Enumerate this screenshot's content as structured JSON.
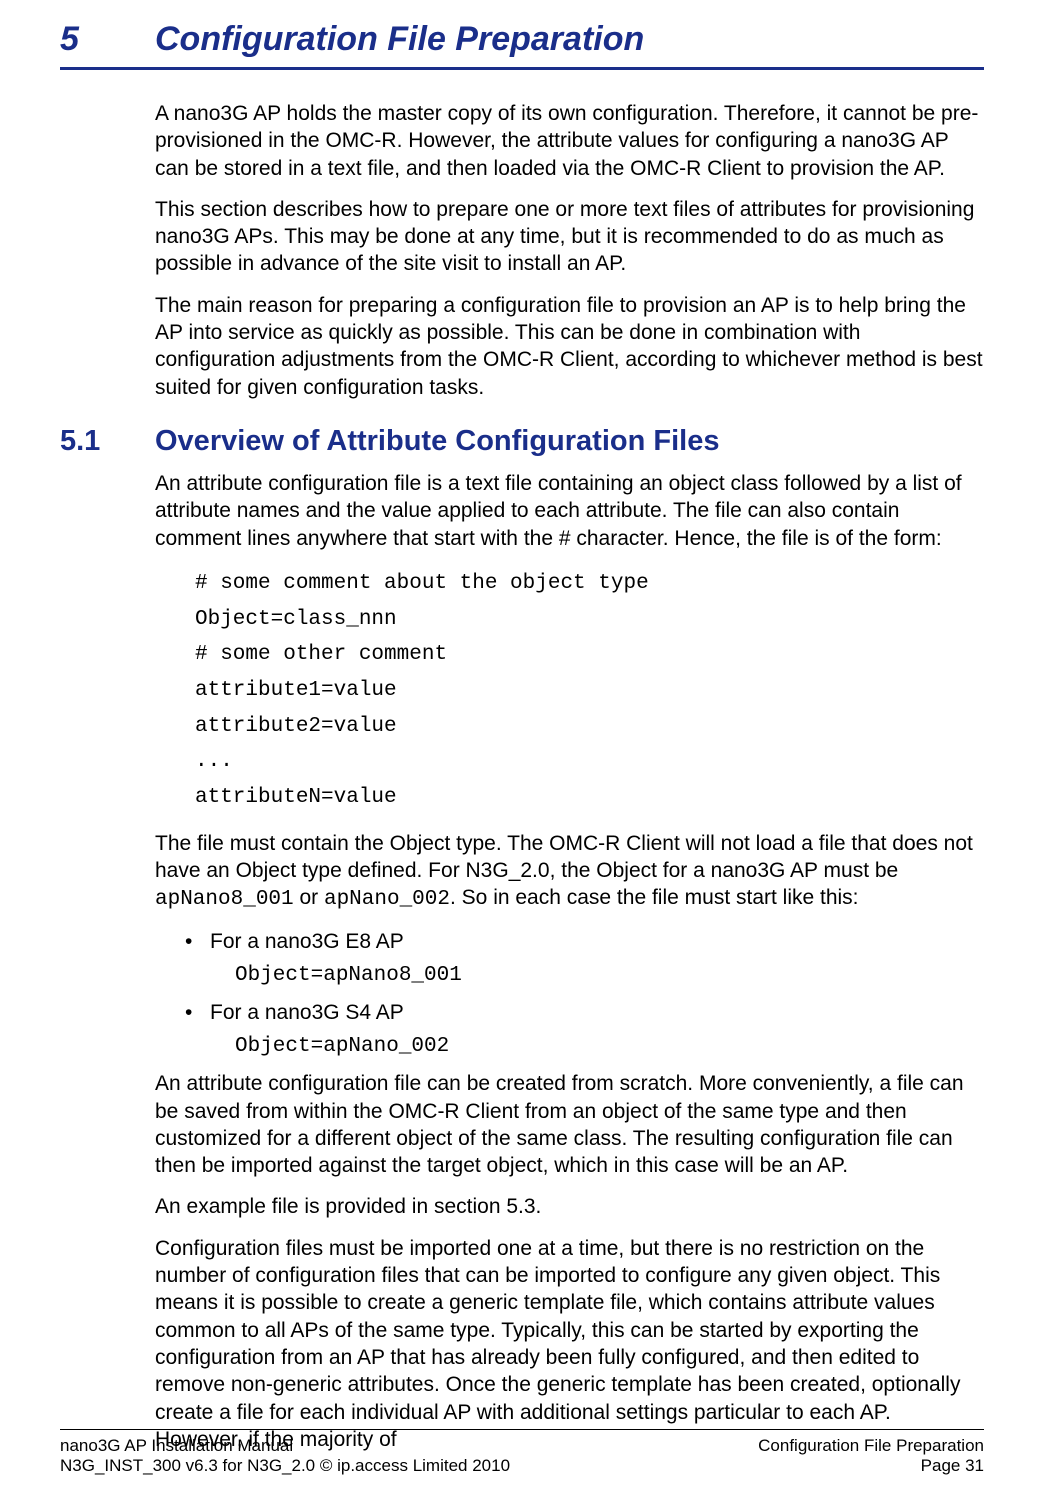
{
  "chapter": {
    "number": "5",
    "title": "Configuration File Preparation"
  },
  "intro": {
    "p1": "A nano3G AP holds the master copy of its own configuration. Therefore, it cannot be pre-provisioned in the OMC-R. However, the attribute values for configuring a nano3G AP can be stored in a text file, and then loaded via the OMC-R Client to provision the AP.",
    "p2": "This section describes how to prepare one or more text files of attributes for provisioning nano3G APs. This may be done at any time, but it is recommended to do as much as possible in advance of the site visit to install an AP.",
    "p3": "The main reason for preparing a configuration file to provision an AP is to help bring the AP into service as quickly as possible. This can be done in combination with configuration adjustments from the OMC-R Client, according to whichever method is best suited for given configuration tasks."
  },
  "section": {
    "number": "5.1",
    "title": "Overview of Attribute Configuration Files",
    "p1": "An attribute configuration file is a text file containing an object class followed by a list of attribute names and the value applied to each attribute. The file can also contain comment lines anywhere that start with the # character. Hence, the file is of the form:",
    "code": {
      "l1": "# some comment about the object type",
      "l2": "Object=class_nnn",
      "l3": "# some other comment",
      "l4": "attribute1=value",
      "l5": "attribute2=value",
      "l6": "...",
      "l7": "attributeN=value"
    },
    "p2a": "The file must contain the Object type. The OMC-R Client will not load a file that does not have an Object type defined. For N3G_2.0, the Object for a nano3G AP must be ",
    "p2code1": "apNano8_001",
    "p2b": " or ",
    "p2code2": "apNano_002",
    "p2c": ". So in each case the file must start like this:",
    "bullets": {
      "b1": "For a nano3G E8 AP",
      "b1code": "Object=apNano8_001",
      "b2": "For a nano3G S4 AP",
      "b2code": "Object=apNano_002"
    },
    "p3": "An attribute configuration file can be created from scratch. More conveniently, a file can be saved from within the OMC-R Client from an object of the same type and then customized for a different object of the same class. The resulting configuration file can then be imported against the target object, which in this case will be an AP.",
    "p4": "An example file is provided in section 5.3.",
    "p5": "Configuration files must be imported one at a time, but there is no restriction on the number of configuration files that can be imported to configure any given object. This means it is possible to create a generic template file, which contains attribute values common to all APs of the same type. Typically, this can be started by exporting the configuration from an AP that has already been fully configured, and then edited to remove non-generic attributes. Once the generic template has been created, optionally create a file for each individual AP with additional settings particular to each AP. However, if the majority of"
  },
  "footer": {
    "left1": "nano3G AP Installation Manual",
    "left2": "N3G_INST_300 v6.3 for N3G_2.0 © ip.access Limited 2010",
    "right1": "Configuration File Preparation",
    "right2": "Page 31"
  }
}
